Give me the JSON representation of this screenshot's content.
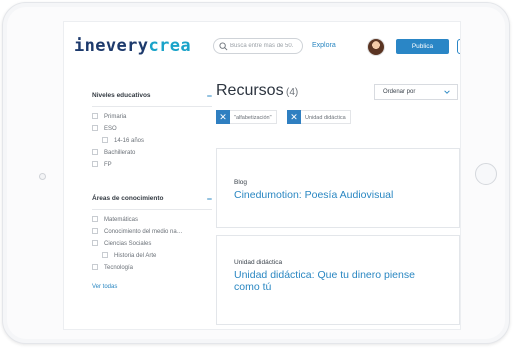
{
  "header": {
    "logo_part1": "inevery",
    "logo_part2": "crea",
    "search_placeholder": "Busca entre más de 50.",
    "explora_label": "Explora",
    "publica_label": "Publica"
  },
  "sidebar": {
    "group1": {
      "title": "Niveles educativos",
      "toggle": "−",
      "options": [
        "Primaria",
        "ESO",
        "14-16 años",
        "Bachillerato",
        "FP"
      ]
    },
    "group2": {
      "title": "Áreas de conocimiento",
      "toggle": "−",
      "options": [
        "Matemáticas",
        "Conocimiento del medio na…",
        "Ciencias Sociales",
        "Historia del Arte",
        "Tecnología"
      ]
    },
    "see_all": "Ver todas"
  },
  "main": {
    "title": "Recursos",
    "count": "(4)",
    "order_label": "Ordenar por",
    "chips": [
      {
        "x": "✕",
        "label": "\"alfabetización\""
      },
      {
        "x": "✕",
        "label": "Unidad didáctica"
      }
    ],
    "cards": [
      {
        "type": "Blog",
        "title": "Cinedumotion: Poesía Audiovisual"
      },
      {
        "type": "Unidad didáctica",
        "title": "Unidad didáctica: Que tu dinero piense como tú"
      }
    ]
  },
  "colors": {
    "accent": "#2a87c2",
    "button": "#2a86c6",
    "logo_dark": "#1d3a6c",
    "logo_light": "#1aa3c9"
  },
  "icons": [
    "search-icon",
    "chevron-down-icon",
    "close-icon"
  ]
}
